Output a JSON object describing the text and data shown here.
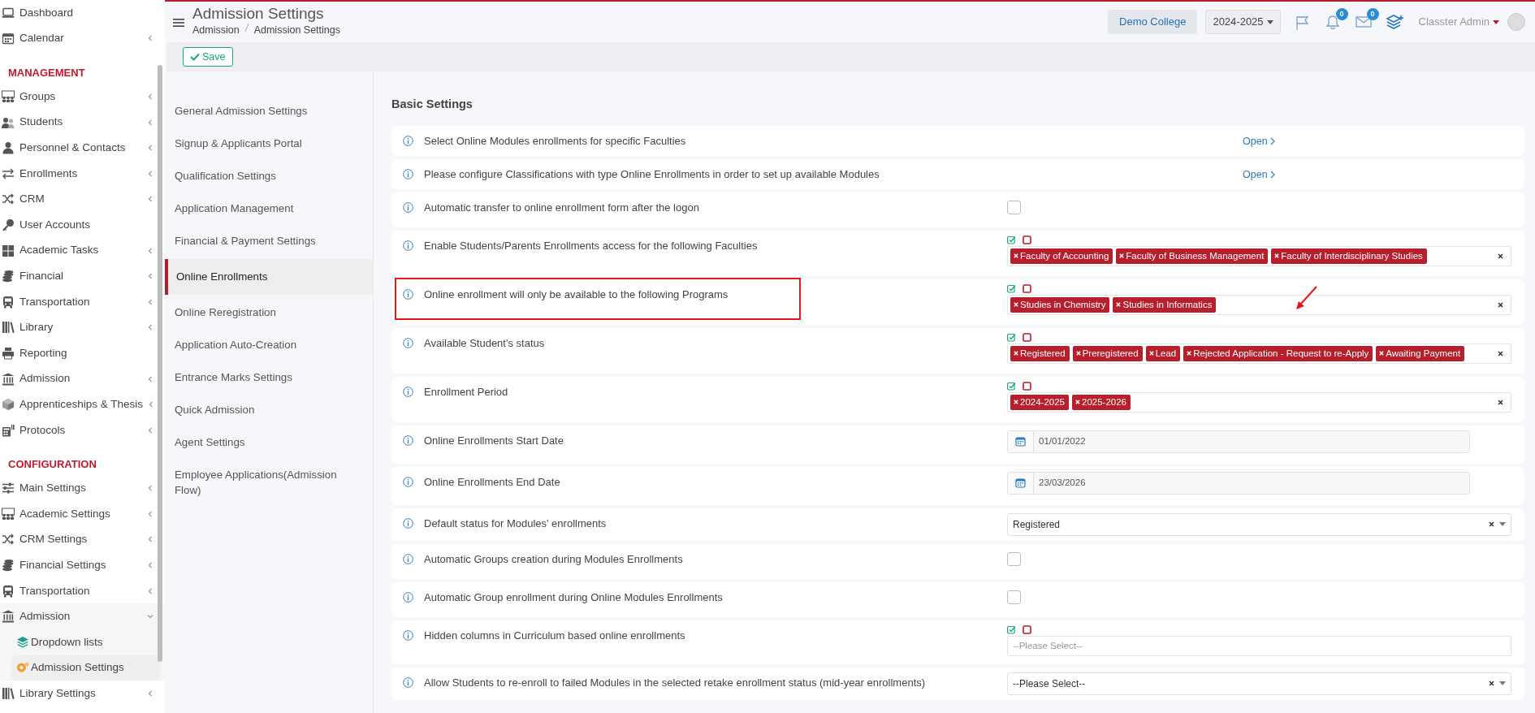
{
  "header": {
    "title": "Admission Settings",
    "breadcrumb": [
      "Admission",
      "Admission Settings"
    ],
    "college": "Demo College",
    "year": "2024-2025",
    "notifications": "0",
    "messages": "0",
    "user": "Classter Admin"
  },
  "toolbar": {
    "save": "Save"
  },
  "sidebar": {
    "sections": [
      {
        "items": [
          {
            "label": "Dashboard",
            "submenu": false,
            "expanded": false,
            "selected": false
          },
          {
            "label": "Calendar",
            "submenu": true,
            "expanded": false,
            "selected": false
          }
        ]
      },
      {
        "heading": "MANAGEMENT",
        "items": [
          {
            "label": "Groups",
            "submenu": true,
            "expanded": false,
            "selected": false
          },
          {
            "label": "Students",
            "submenu": true,
            "expanded": false,
            "selected": false
          },
          {
            "label": "Personnel & Contacts",
            "submenu": true,
            "expanded": false,
            "selected": false
          },
          {
            "label": "Enrollments",
            "submenu": true,
            "expanded": false,
            "selected": false
          },
          {
            "label": "CRM",
            "submenu": true,
            "expanded": false,
            "selected": false
          },
          {
            "label": "User Accounts",
            "submenu": false,
            "expanded": false,
            "selected": false
          },
          {
            "label": "Academic Tasks",
            "submenu": true,
            "expanded": false,
            "selected": false
          },
          {
            "label": "Financial",
            "submenu": true,
            "expanded": false,
            "selected": false
          },
          {
            "label": "Transportation",
            "submenu": true,
            "expanded": false,
            "selected": false
          },
          {
            "label": "Library",
            "submenu": true,
            "expanded": false,
            "selected": false
          },
          {
            "label": "Reporting",
            "submenu": false,
            "expanded": false,
            "selected": false
          },
          {
            "label": "Admission",
            "submenu": true,
            "expanded": false,
            "selected": false
          },
          {
            "label": "Apprenticeships & Thesis",
            "submenu": true,
            "expanded": false,
            "selected": false
          },
          {
            "label": "Protocols",
            "submenu": true,
            "expanded": false,
            "selected": false
          }
        ]
      },
      {
        "heading": "CONFIGURATION",
        "items": [
          {
            "label": "Main Settings",
            "submenu": true,
            "expanded": false,
            "selected": false
          },
          {
            "label": "Academic Settings",
            "submenu": true,
            "expanded": false,
            "selected": false
          },
          {
            "label": "CRM Settings",
            "submenu": true,
            "expanded": false,
            "selected": false
          },
          {
            "label": "Financial Settings",
            "submenu": true,
            "expanded": false,
            "selected": false
          },
          {
            "label": "Transportation",
            "submenu": true,
            "expanded": false,
            "selected": false
          },
          {
            "label": "Admission",
            "submenu": true,
            "expanded": true,
            "selected": false,
            "children": [
              {
                "label": "Dropdown lists",
                "submenu": false,
                "expanded": false,
                "selected": false
              },
              {
                "label": "Admission Settings",
                "submenu": false,
                "expanded": false,
                "selected": true
              }
            ]
          },
          {
            "label": "Library Settings",
            "submenu": true,
            "expanded": false,
            "selected": false
          }
        ]
      }
    ]
  },
  "settings_nav": [
    {
      "label": "General Admission Settings",
      "selected": false
    },
    {
      "label": "Signup & Applicants Portal",
      "selected": false
    },
    {
      "label": "Qualification Settings",
      "selected": false
    },
    {
      "label": "Application Management",
      "selected": false
    },
    {
      "label": "Financial & Payment Settings",
      "selected": false
    },
    {
      "label": "Online Enrollments",
      "selected": true
    },
    {
      "label": "Online Reregistration",
      "selected": false
    },
    {
      "label": "Application Auto-Creation",
      "selected": false
    },
    {
      "label": "Entrance Marks Settings",
      "selected": false
    },
    {
      "label": "Quick Admission",
      "selected": false
    },
    {
      "label": "Agent Settings",
      "selected": false
    },
    {
      "label": "Employee Applications(Admission Flow)",
      "selected": false
    }
  ],
  "content": {
    "heading": "Basic Settings",
    "rows": [
      {
        "kind": "link",
        "label": "Select Online Modules enrollments for specific Faculties",
        "link": "Open",
        "highlighted": false,
        "arrow": false
      },
      {
        "kind": "link",
        "label": "Please configure Classifications with type Online Enrollments in order to set up available Modules",
        "link": "Open",
        "highlighted": false,
        "arrow": false
      },
      {
        "kind": "checkbox",
        "label": "Automatic transfer to online enrollment form after the logon",
        "checked": false,
        "highlighted": false,
        "arrow": false
      },
      {
        "kind": "tags",
        "label": "Enable Students/Parents Enrollments access for the following Faculties",
        "tags": [
          "Faculty of Accounting",
          "Faculty of Business Management",
          "Faculty of Interdisciplinary Studies"
        ],
        "highlighted": false,
        "arrow": false
      },
      {
        "kind": "tags",
        "label": "Online enrollment will only be available to the following Programs",
        "tags": [
          "Studies in Chemistry",
          "Studies in Informatics"
        ],
        "highlighted": true,
        "arrow": true
      },
      {
        "kind": "tags",
        "label": "Available Student's status",
        "tags": [
          "Registered",
          "Preregistered",
          "Lead",
          "Rejected Application - Request to re-Apply",
          "Awaiting Payment"
        ],
        "highlighted": false,
        "arrow": false
      },
      {
        "kind": "tags",
        "label": "Enrollment Period",
        "tags": [
          "2024-2025",
          "2025-2026"
        ],
        "highlighted": false,
        "arrow": false
      },
      {
        "kind": "date",
        "label": "Online Enrollments Start Date",
        "value": "01/01/2022",
        "highlighted": false,
        "arrow": false
      },
      {
        "kind": "date",
        "label": "Online Enrollments End Date",
        "value": "23/03/2026",
        "highlighted": false,
        "arrow": false
      },
      {
        "kind": "select",
        "label": "Default status for Modules' enrollments",
        "value": "Registered",
        "highlighted": false,
        "arrow": false
      },
      {
        "kind": "checkbox",
        "label": "Automatic Groups creation during Modules Enrollments",
        "checked": false,
        "highlighted": false,
        "arrow": false
      },
      {
        "kind": "checkbox",
        "label": "Automatic Group enrollment during Online Modules Enrollments",
        "checked": false,
        "highlighted": false,
        "arrow": false
      },
      {
        "kind": "tags",
        "label": "Hidden columns in Curriculum based online enrollments",
        "placeholder": "--Please Select--",
        "highlighted": false,
        "arrow": false
      },
      {
        "kind": "select",
        "label": "Allow Students to re-enroll to failed Modules in the selected retake enrollment status (mid-year enrollments)",
        "value": "--Please Select--",
        "highlighted": false,
        "arrow": false
      }
    ]
  }
}
